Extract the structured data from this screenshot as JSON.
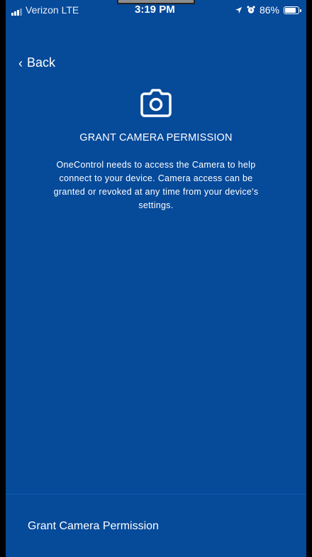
{
  "status_bar": {
    "carrier": "Verizon  LTE",
    "time": "3:19 PM",
    "battery": "86%",
    "battery_level": 0.86
  },
  "nav": {
    "back_label": "Back"
  },
  "permission": {
    "title": "GRANT CAMERA PERMISSION",
    "description": "OneControl needs to access the Camera to help connect to your device. Camera access can be granted or revoked at any time from your device's settings."
  },
  "footer": {
    "button_label": "Grant Camera Permission"
  },
  "colors": {
    "background": "#064a9a",
    "text": "#ffffff"
  }
}
